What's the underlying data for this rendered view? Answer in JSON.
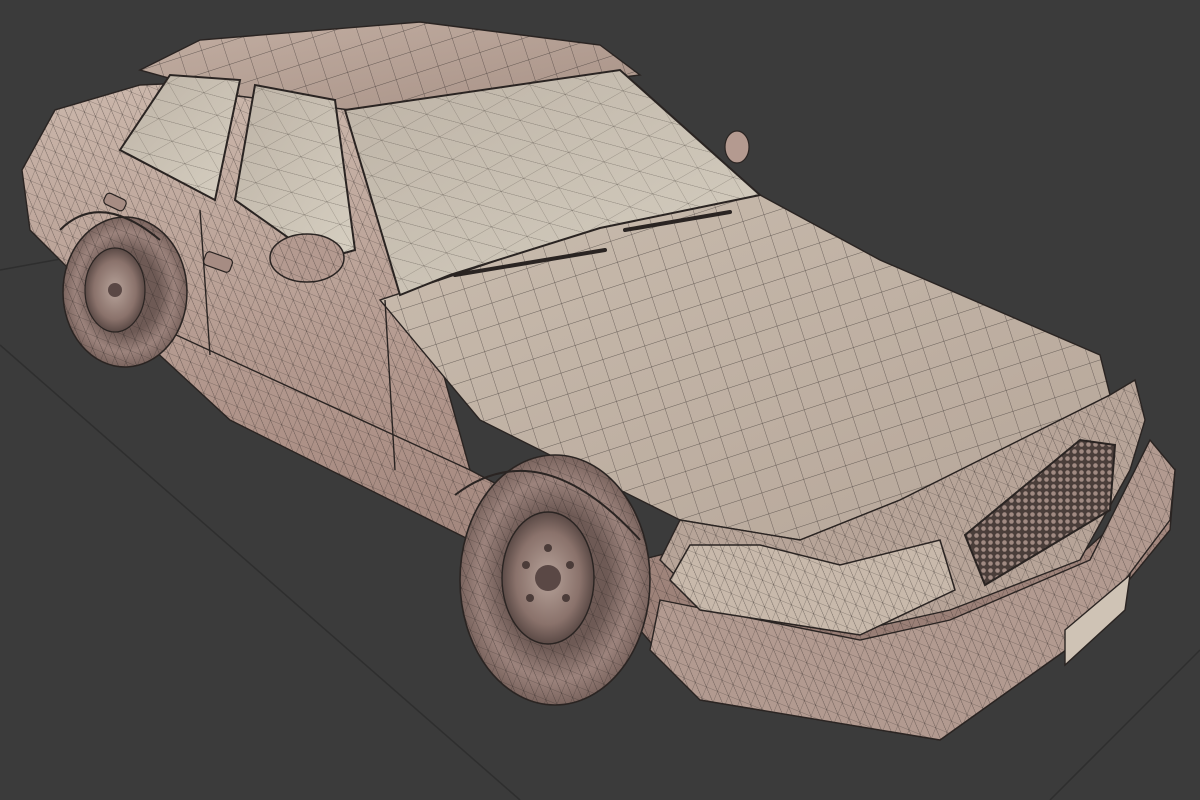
{
  "viewport": {
    "background_color": "#3b3b3b",
    "grid_line_color": "#2c2c2c",
    "display_mode": "shaded-with-wireframe",
    "subject": "sedan-car-3d-model"
  },
  "model": {
    "base_color": "#b49a90",
    "shadow_color": "#7d6660",
    "highlight_color": "#d2c3b5",
    "glass_color": "#c9c1b3",
    "wire_color": "#2a2422",
    "tire_color": "#8c7570"
  }
}
